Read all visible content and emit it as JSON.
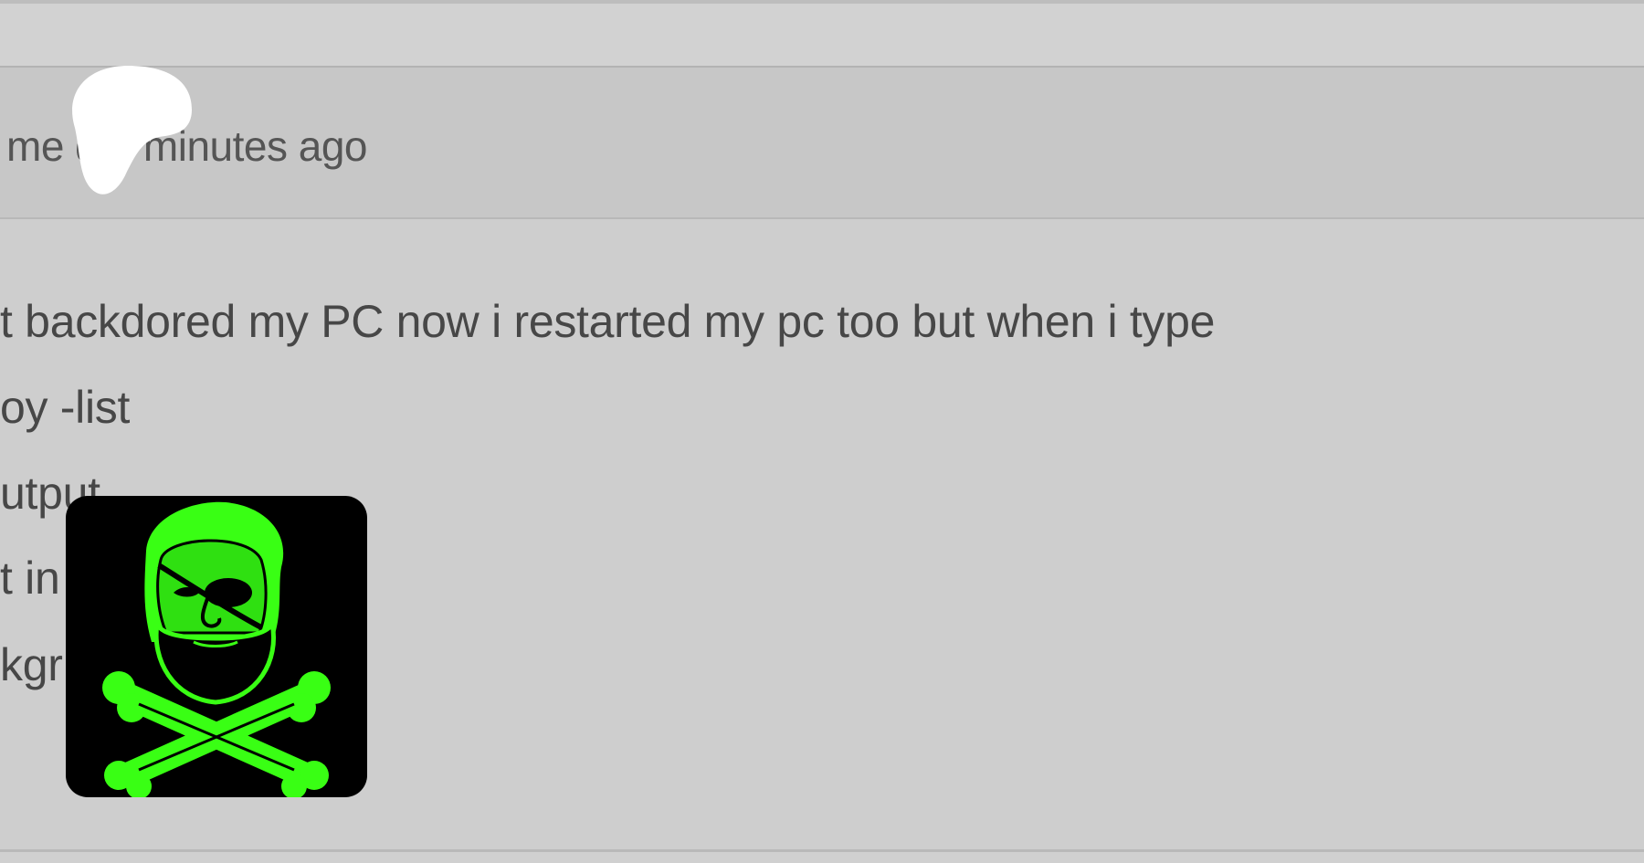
{
  "post": {
    "meta_text": "me    d 4 minutes ago",
    "body_lines": [
      "t backdored my PC now i restarted my pc too but when i type",
      "oy -list",
      "utput",
      "t in",
      "kgr                  ning"
    ]
  },
  "avatar": {
    "icon": "pirate-lincoln-skull-icon"
  },
  "colors": {
    "background": "#cfcfcf",
    "header_band": "#c7c7c7",
    "text": "#474747",
    "avatar_green": "#39ff14"
  }
}
